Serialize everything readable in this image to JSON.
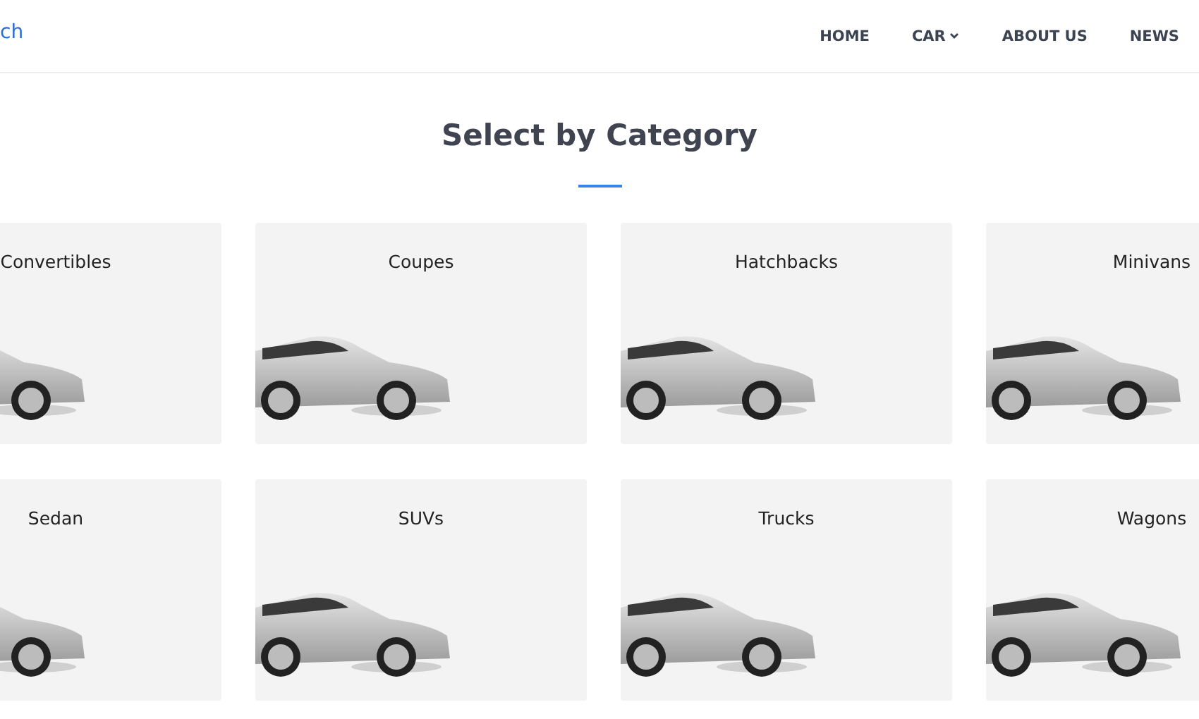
{
  "header": {
    "logo": "ch",
    "nav": [
      {
        "label": "HOME",
        "dropdown": false
      },
      {
        "label": "CAR",
        "dropdown": true
      },
      {
        "label": "ABOUT US",
        "dropdown": false
      },
      {
        "label": "NEWS",
        "dropdown": false
      }
    ]
  },
  "section": {
    "title": "Select by Category"
  },
  "categories": [
    {
      "label": "Convertibles"
    },
    {
      "label": "Coupes"
    },
    {
      "label": "Hatchbacks"
    },
    {
      "label": "Minivans"
    },
    {
      "label": "Sedan"
    },
    {
      "label": "SUVs"
    },
    {
      "label": "Trucks"
    },
    {
      "label": "Wagons"
    }
  ]
}
